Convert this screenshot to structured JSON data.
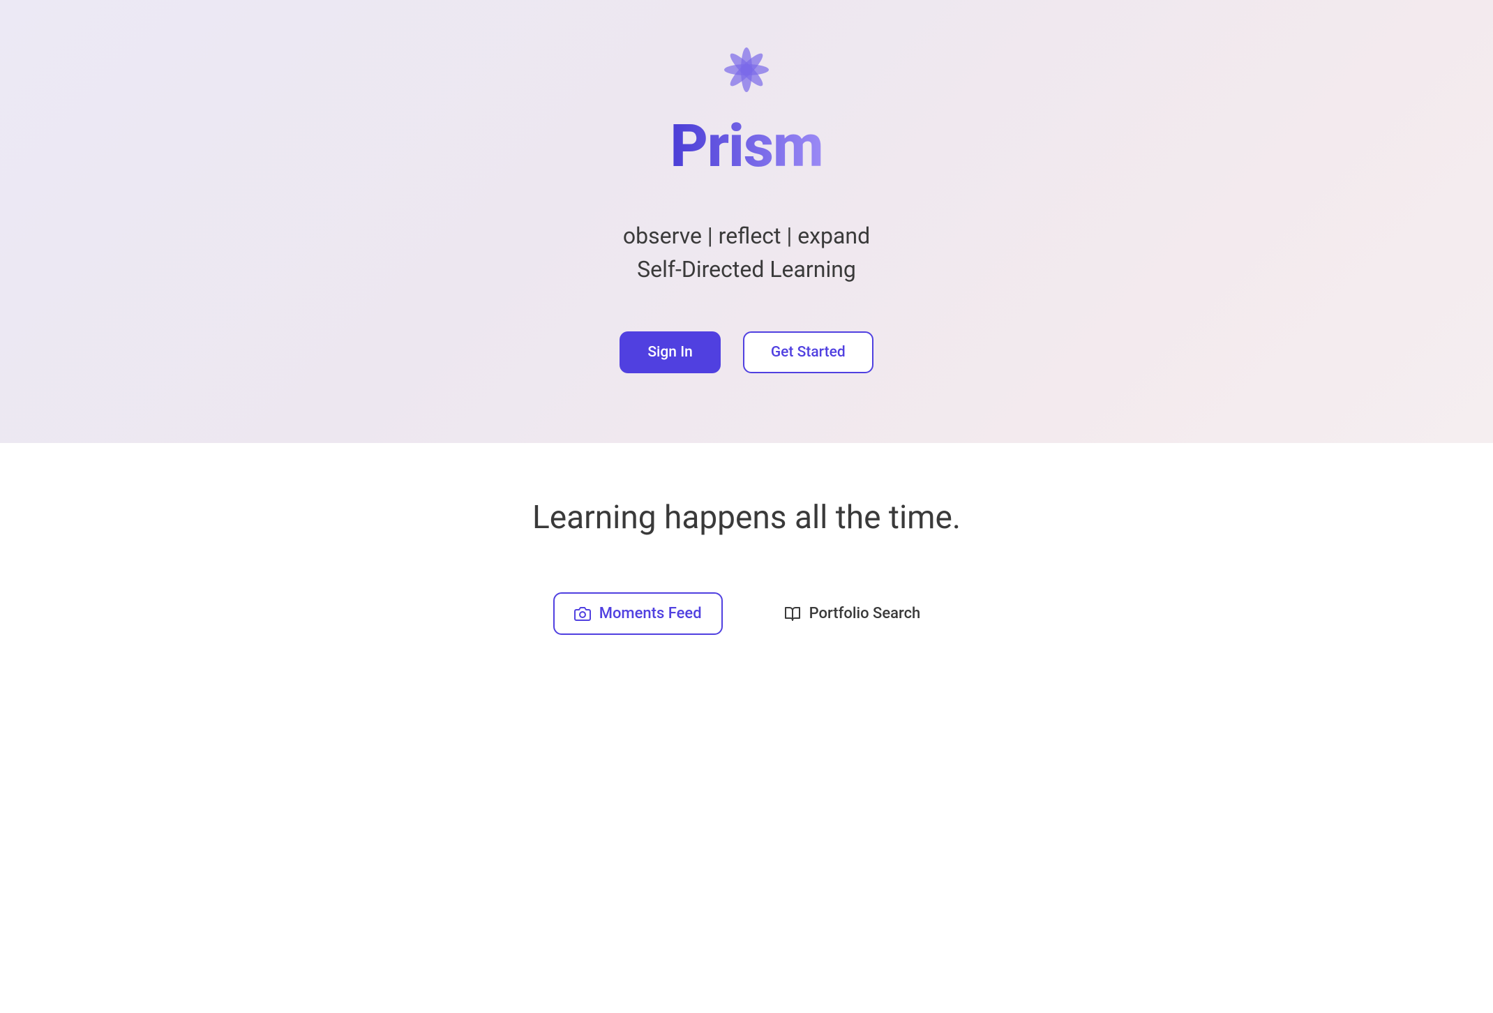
{
  "hero": {
    "brand": "Prism",
    "tagline": "observe | reflect | expand",
    "subtitle": "Self-Directed Learning",
    "sign_in_label": "Sign In",
    "get_started_label": "Get Started"
  },
  "content": {
    "heading": "Learning happens all the time.",
    "tabs": {
      "moments_feed": "Moments Feed",
      "portfolio_search": "Portfolio Search"
    }
  },
  "colors": {
    "primary": "#5040e0",
    "gradient_start": "#4a3dd6",
    "gradient_end": "#9b8af5"
  }
}
